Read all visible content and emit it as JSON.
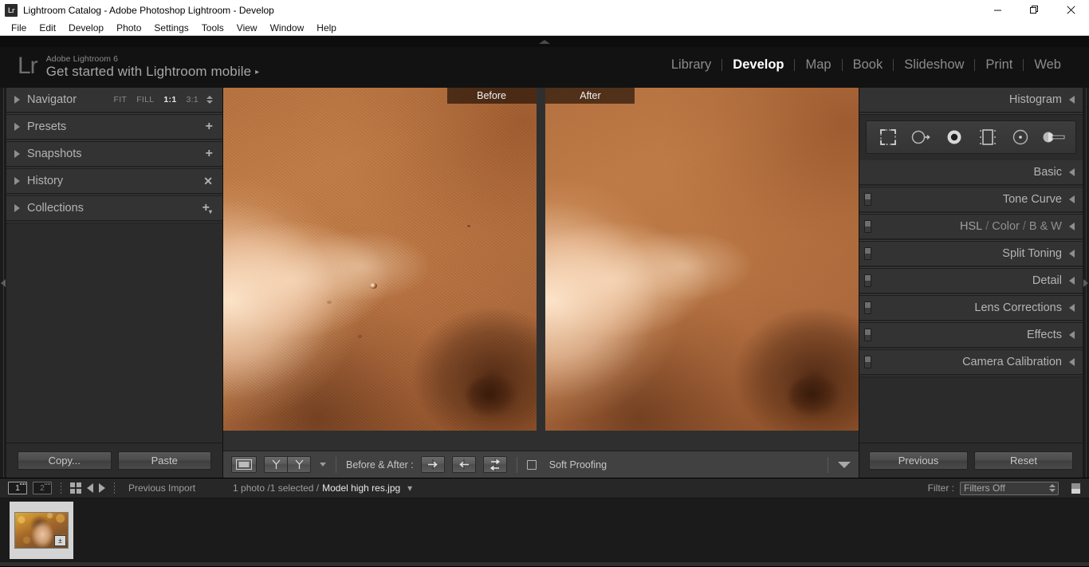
{
  "window": {
    "title": "Lightroom Catalog - Adobe Photoshop Lightroom - Develop",
    "app_icon": "Lr",
    "controls": {
      "minimize": "minimize-icon",
      "maximize": "restore-icon",
      "close": "close-icon"
    }
  },
  "menubar": {
    "items": [
      "File",
      "Edit",
      "Develop",
      "Photo",
      "Settings",
      "Tools",
      "View",
      "Window",
      "Help"
    ]
  },
  "identity": {
    "logo": "Lr",
    "product": "Adobe Lightroom 6",
    "tagline": "Get started with Lightroom mobile",
    "tagline_arrow": "▸"
  },
  "modules": [
    {
      "label": "Library",
      "active": false
    },
    {
      "label": "Develop",
      "active": true
    },
    {
      "label": "Map",
      "active": false
    },
    {
      "label": "Book",
      "active": false
    },
    {
      "label": "Slideshow",
      "active": false
    },
    {
      "label": "Print",
      "active": false
    },
    {
      "label": "Web",
      "active": false
    }
  ],
  "left_panel": {
    "navigator": {
      "label": "Navigator",
      "zoom_levels": [
        {
          "label": "FIT",
          "active": false
        },
        {
          "label": "FILL",
          "active": false
        },
        {
          "label": "1:1",
          "active": true
        },
        {
          "label": "3:1",
          "active": false
        }
      ]
    },
    "sections": [
      {
        "label": "Presets",
        "action": "plus-icon"
      },
      {
        "label": "Snapshots",
        "action": "plus-icon"
      },
      {
        "label": "History",
        "action": "close-icon"
      },
      {
        "label": "Collections",
        "action": "plus-dropdown-icon"
      }
    ],
    "footer": {
      "copy": "Copy...",
      "paste": "Paste"
    }
  },
  "image_view": {
    "before_label": "Before",
    "after_label": "After"
  },
  "toolbar": {
    "view_mode_icon": "loupe-view-icon",
    "flag_icons": [
      "flag-pick-icon",
      "flag-reject-icon"
    ],
    "before_after_label": "Before & After :",
    "copy_settings_icons": [
      "copy-before-to-after-icon",
      "copy-after-to-before-icon",
      "swap-before-after-icon"
    ],
    "soft_proofing_label": "Soft Proofing",
    "soft_proofing_checked": false,
    "toolbar_toggle_icon": "chevron-down-icon"
  },
  "right_panel": {
    "histogram": {
      "label": "Histogram"
    },
    "tools": [
      "crop-overlay-icon",
      "spot-removal-icon",
      "red-eye-correction-icon",
      "graduated-filter-icon",
      "radial-filter-icon",
      "adjustment-brush-icon"
    ],
    "sections": [
      {
        "label": "Basic",
        "switch": false
      },
      {
        "label": "Tone Curve",
        "switch": true
      },
      {
        "label": "HSL / Color / B & W",
        "switch": true,
        "parts": [
          "HSL",
          "Color",
          "B & W"
        ]
      },
      {
        "label": "Split Toning",
        "switch": true
      },
      {
        "label": "Detail",
        "switch": true
      },
      {
        "label": "Lens Corrections",
        "switch": true
      },
      {
        "label": "Effects",
        "switch": true
      },
      {
        "label": "Camera Calibration",
        "switch": true
      }
    ],
    "footer": {
      "previous": "Previous",
      "reset": "Reset"
    }
  },
  "filmstrip": {
    "page_indicators": [
      {
        "label": "1",
        "active": true
      },
      {
        "label": "2",
        "active": false
      }
    ],
    "grid_icon": "grid-view-icon",
    "back_icon": "navigate-back-icon",
    "forward_icon": "navigate-forward-icon",
    "source": "Previous Import",
    "selection_count": "1 photo /1 selected /",
    "filename": "Model high res.jpg",
    "filename_caret": "▾",
    "filter_label": "Filter :",
    "filter_value": "Filters Off",
    "lock_icon": "filter-lock-icon",
    "thumbnail": {
      "badge": "develop-badge-icon",
      "badge_glyph": "±"
    }
  }
}
